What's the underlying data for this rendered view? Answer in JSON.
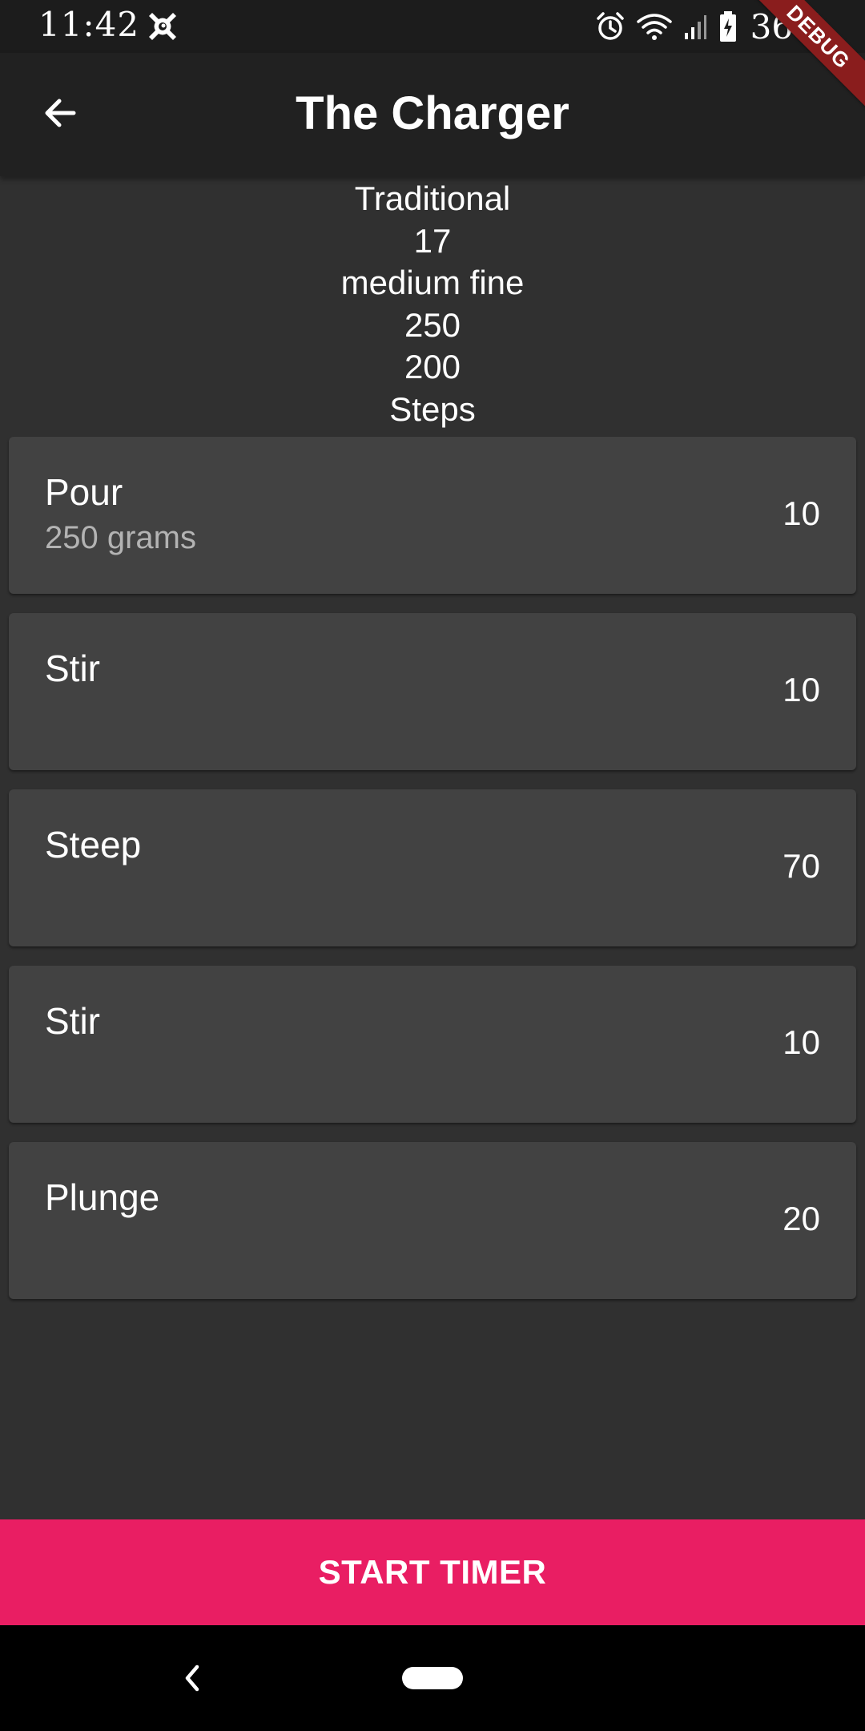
{
  "status_bar": {
    "time": "11:42",
    "notification_icon": "app-notification-icon",
    "alarm_icon": "alarm-icon",
    "wifi_icon": "wifi-icon",
    "signal_icon": "cell-signal-icon",
    "battery_icon": "battery-charging-icon",
    "battery_percent": "36%"
  },
  "debug_banner": "DEBUG",
  "app_bar": {
    "back_icon": "arrow-back-icon",
    "title": "The Charger"
  },
  "recipe": {
    "method": "Traditional",
    "coffee_amount": "17",
    "grind": "medium fine",
    "water_amount": "250",
    "temperature": "200",
    "steps_heading": "Steps"
  },
  "steps": [
    {
      "name": "Pour",
      "detail": "250 grams",
      "duration": "10"
    },
    {
      "name": "Stir",
      "detail": "",
      "duration": "10"
    },
    {
      "name": "Steep",
      "detail": "",
      "duration": "70"
    },
    {
      "name": "Stir",
      "detail": "",
      "duration": "10"
    },
    {
      "name": "Plunge",
      "detail": "",
      "duration": "20"
    }
  ],
  "start_button": {
    "label": "START TIMER"
  },
  "nav_bar": {
    "back_icon": "nav-back-icon",
    "home_icon": "nav-home-pill"
  },
  "colors": {
    "background": "#303030",
    "app_bar": "#212121",
    "card": "#424242",
    "accent": "#e91e63",
    "debug_ribbon": "#8a1d1d"
  }
}
